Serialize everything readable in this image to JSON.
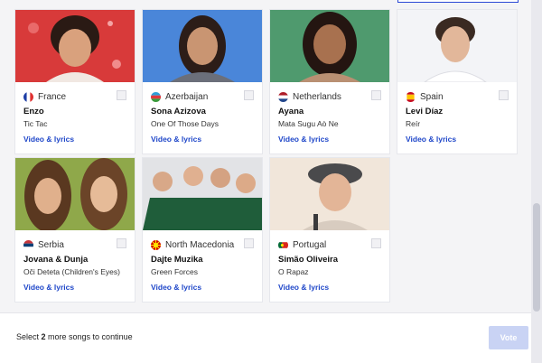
{
  "entries": [
    {
      "country": "France",
      "artist": "Enzo",
      "song": "Tic Tac",
      "link": "Video & lyrics",
      "flag": "france-flag-icon"
    },
    {
      "country": "Azerbaijan",
      "artist": "Sona Azizova",
      "song": "One Of Those Days",
      "link": "Video & lyrics",
      "flag": "azerbaijan-flag-icon"
    },
    {
      "country": "Netherlands",
      "artist": "Ayana",
      "song": "Mata Sugu Aò Ne",
      "link": "Video & lyrics",
      "flag": "netherlands-flag-icon"
    },
    {
      "country": "Spain",
      "artist": "Levi Díaz",
      "song": "Reír",
      "link": "Video & lyrics",
      "flag": "spain-flag-icon"
    },
    {
      "country": "Serbia",
      "artist": "Jovana & Dunja",
      "song": "Oči Deteta (Children's Eyes)",
      "link": "Video & lyrics",
      "flag": "serbia-flag-icon"
    },
    {
      "country": "North Macedonia",
      "artist": "Dajte Muzika",
      "song": "Green Forces",
      "link": "Video & lyrics",
      "flag": "north-macedonia-flag-icon"
    },
    {
      "country": "Portugal",
      "artist": "Simão Oliveira",
      "song": "O Rapaz",
      "link": "Video & lyrics",
      "flag": "portugal-flag-icon"
    }
  ],
  "footer": {
    "prefix": "Select ",
    "count": "2",
    "suffix": " more songs to continue",
    "vote_label": "Vote"
  },
  "colors": {
    "link": "#1f47c9",
    "vote_disabled": "#c9d3f4",
    "background": "#1f2d6b"
  }
}
